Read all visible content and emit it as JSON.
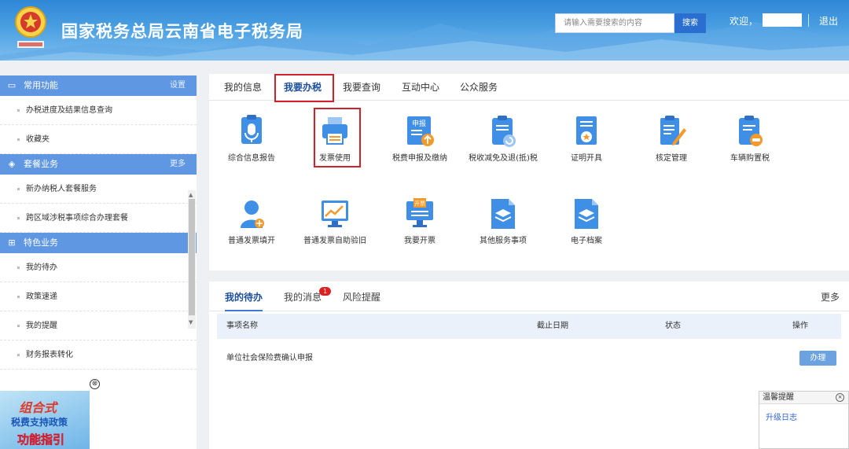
{
  "header": {
    "site_title": "国家税务总局云南省电子税务局",
    "search_placeholder": "请输入需要搜索的内容",
    "search_button": "搜索",
    "welcome": "欢迎，",
    "logout": "退出"
  },
  "sidebar": {
    "sections": [
      {
        "title": "常用功能",
        "link": "设置",
        "icon": "window-icon",
        "items": [
          "办税进度及结果信息查询",
          "收藏夹"
        ]
      },
      {
        "title": "套餐业务",
        "link": "更多",
        "icon": "stack-icon",
        "items": [
          "新办纳税人套餐服务",
          "跨区域涉税事项综合办理套餐"
        ]
      },
      {
        "title": "特色业务",
        "link": "",
        "icon": "grid-icon",
        "items": [
          "我的待办",
          "政策速递",
          "我的提醒",
          "财务报表转化"
        ]
      }
    ],
    "promo": {
      "line1": "组合式",
      "line2": "税费支持政策",
      "line3": "功能指引",
      "close": "⊗"
    }
  },
  "main_tabs": [
    "我的信息",
    "我要办税",
    "我要查询",
    "互动中心",
    "公众服务"
  ],
  "active_main_tab": "我要办税",
  "services": [
    {
      "label": "综合信息报告",
      "icon": "report-mic-icon"
    },
    {
      "label": "发票使用",
      "icon": "printer-icon"
    },
    {
      "label": "税费申报及缴纳",
      "icon": "declare-upload-icon",
      "icon_text": "申报"
    },
    {
      "label": "税收减免及退(抵)税",
      "icon": "clipboard-refund-icon"
    },
    {
      "label": "证明开具",
      "icon": "certificate-icon"
    },
    {
      "label": "核定管理",
      "icon": "edit-doc-icon"
    },
    {
      "label": "车辆购置税",
      "icon": "clipboard-car-icon"
    },
    {
      "label": "普通发票填开",
      "icon": "person-scale-icon"
    },
    {
      "label": "普通发票自助验旧",
      "icon": "monitor-chart-icon"
    },
    {
      "label": "我要开票",
      "icon": "invoice-screen-icon",
      "icon_text": "开票"
    },
    {
      "label": "其他服务事项",
      "icon": "layers-doc-icon"
    },
    {
      "label": "电子档案",
      "icon": "archive-doc-icon"
    }
  ],
  "todo_tabs": [
    "我的待办",
    "我的消息",
    "风险提醒"
  ],
  "todo_badge": "1",
  "todo_more": "更多",
  "table": {
    "headers": [
      "事项名称",
      "截止日期",
      "状态",
      "操作"
    ],
    "rows": [
      {
        "name": "单位社会保险费确认申报",
        "date": "",
        "status": "",
        "action": "办理"
      }
    ]
  },
  "tips": {
    "title": "温馨提醒",
    "link": "升级日志"
  },
  "colors": {
    "primary": "#3c7ad8",
    "sidebar_head": "#5f97e2",
    "highlight": "#d12229",
    "icon_blue": "#3f8fe6",
    "icon_orange": "#f39a2b"
  }
}
